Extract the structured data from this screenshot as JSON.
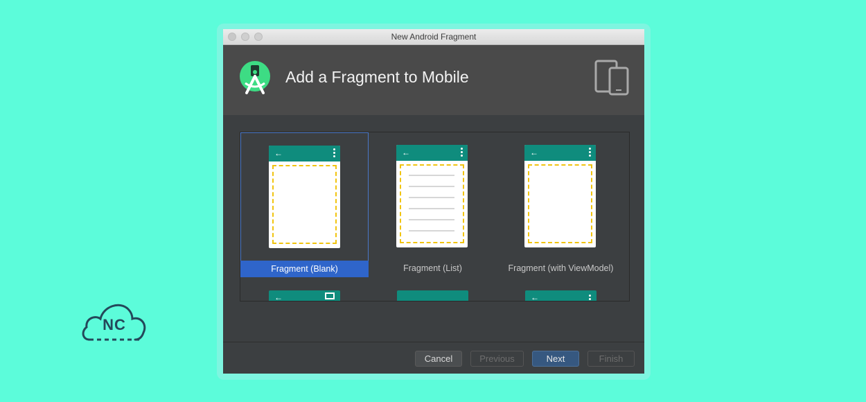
{
  "window": {
    "title": "New Android Fragment"
  },
  "header": {
    "title": "Add a Fragment to Mobile"
  },
  "templates": [
    {
      "label": "Fragment (Blank)",
      "selected": true
    },
    {
      "label": "Fragment (List)",
      "selected": false
    },
    {
      "label": "Fragment (with ViewModel)",
      "selected": false
    }
  ],
  "buttons": {
    "cancel": "Cancel",
    "previous": "Previous",
    "next": "Next",
    "finish": "Finish"
  },
  "brand": {
    "text": "NC"
  },
  "icons": {
    "back": "arrow-left-icon",
    "overflow": "more-vert-icon",
    "fullscreen": "fullscreen-icon",
    "devices": "phone-tablet-icon",
    "logo": "android-studio-logo-icon"
  },
  "colors": {
    "background": "#5cfcda",
    "appbar": "#0f8c7d",
    "selection": "#2f65ca",
    "dashed_border": "#f1c40f"
  }
}
